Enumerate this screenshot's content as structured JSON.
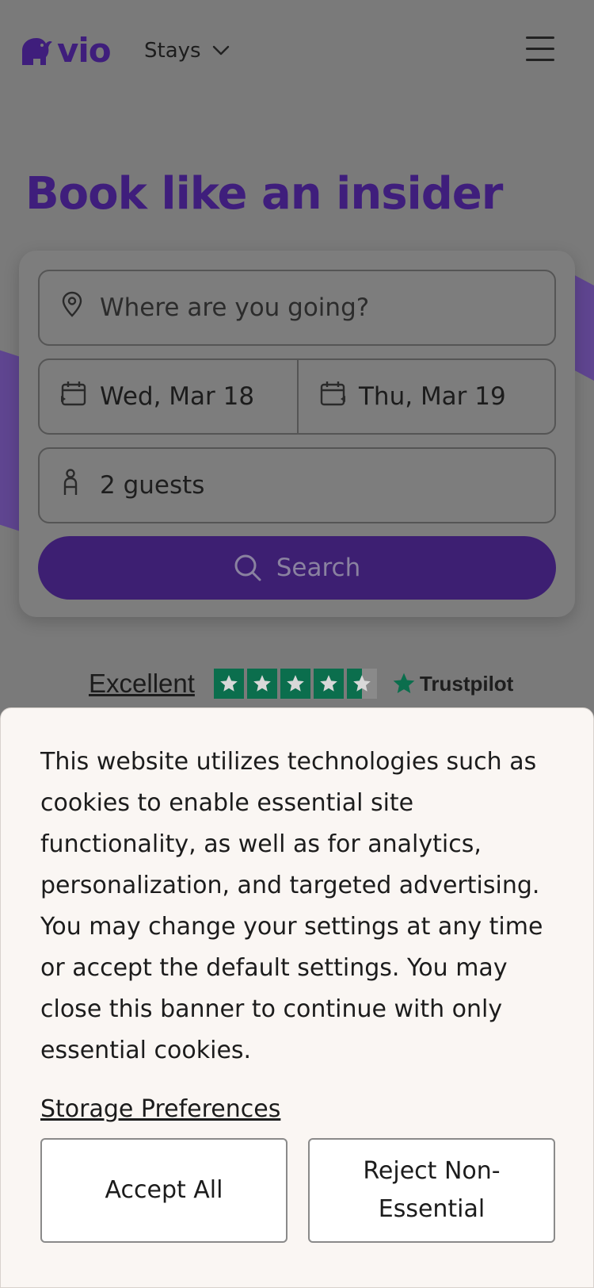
{
  "header": {
    "brand": "vio",
    "nav_label": "Stays"
  },
  "hero": {
    "title": "Book like an insider"
  },
  "search": {
    "destination_placeholder": "Where are you going?",
    "check_in": "Wed, Mar 18",
    "check_out": "Thu, Mar 19",
    "guests": "2 guests",
    "button_label": "Search"
  },
  "trust": {
    "rating_label": "Excellent",
    "stars": 4.5,
    "provider": "Trustpilot"
  },
  "cookie_banner": {
    "message": "This website utilizes technologies such as cookies to enable essential site functionality, as well as for analytics, personalization, and targeted advertising. You may change your settings at any time or accept the default settings. You may close this banner to continue with only essential cookies.",
    "storage_link": "Storage Preferences",
    "accept_label": "Accept All",
    "reject_label": "Reject Non-Essential"
  },
  "colors": {
    "brand_purple": "#3f1e7c",
    "trustpilot_green": "#0b6e4d",
    "banner_bg": "#faf6f3"
  }
}
